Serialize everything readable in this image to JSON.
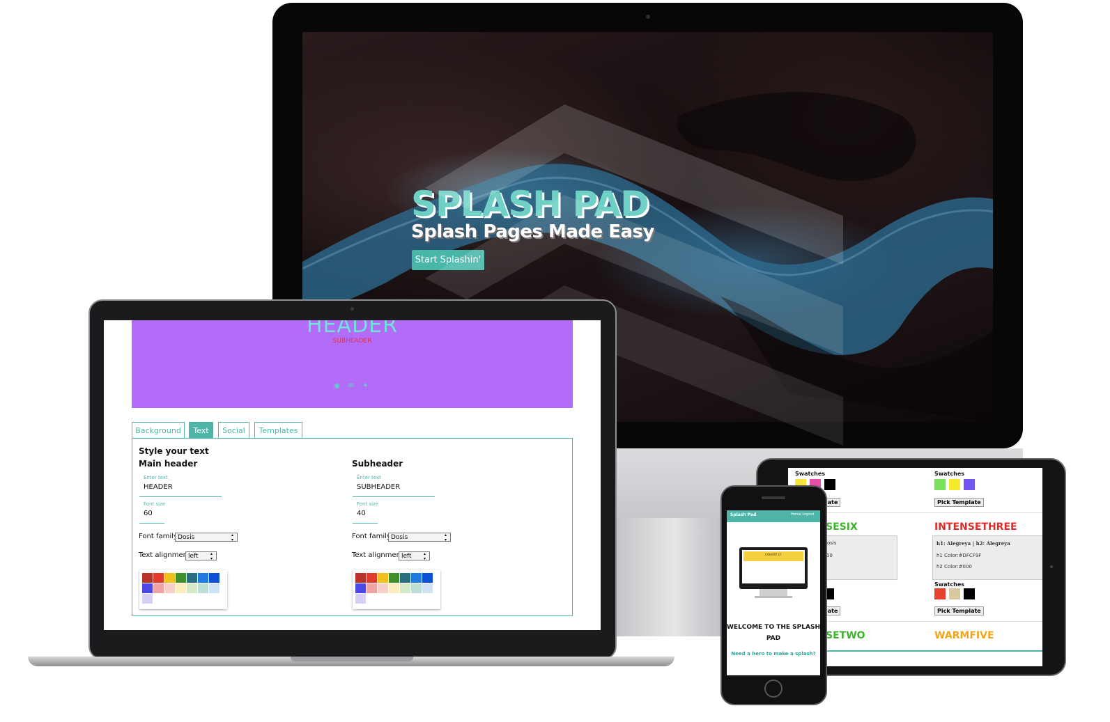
{
  "hero": {
    "title": "SPLASH PAD",
    "subtitle": "Splash Pages Made Easy",
    "cta": "Start Splashin'"
  },
  "editor": {
    "preview": {
      "header": "HEADER",
      "subheader": "SUBHEADER",
      "social_icons": [
        "github-icon",
        "mail-icon",
        "twitter-icon"
      ]
    },
    "tabs": [
      "Background",
      "Text",
      "Social",
      "Templates"
    ],
    "active_tab": "Text",
    "section_title": "Style your text",
    "main": {
      "title": "Main header",
      "text_label": "Enter text",
      "text_value": "HEADER",
      "size_label": "Font size",
      "size_value": "60",
      "family_label": "Font family",
      "family_value": "Dosis",
      "align_label": "Text alignment",
      "align_value": "left"
    },
    "sub": {
      "title": "Subheader",
      "text_label": "Enter text",
      "text_value": "SUBHEADER",
      "size_label": "Font size",
      "size_value": "40",
      "family_label": "Font family",
      "family_value": "Dosis",
      "align_label": "Text alignment",
      "align_value": "left"
    },
    "palette_colors": [
      "#b8322a",
      "#e23b2e",
      "#f2c01c",
      "#3f8f2a",
      "#2b6f7f",
      "#1f7ae0",
      "#0b4fd6",
      "#4c47e6",
      "#f0a3a3",
      "#f6d0c8",
      "#fbeebe",
      "#d5e8c8",
      "#bcded6",
      "#cfe2f4",
      "#d6d0f6"
    ]
  },
  "tablet": {
    "swatches_label": "Swatches",
    "pick_label": "Pick Template",
    "pick_label_cut": "late",
    "templates": [
      {
        "name": "SESIX",
        "color": "#3db42b"
      },
      {
        "name": "INTENSETHREE",
        "color": "#e22828"
      },
      {
        "name": "SETWO",
        "color": "#3db42b"
      },
      {
        "name": "WARMFIVE",
        "color": "#f2a51c"
      }
    ],
    "card_left": {
      "line1": ": Dosis",
      "line2": "0000",
      "line3": "0"
    },
    "card_right": {
      "line1": "h1: Alegreya | h2: Alegreya",
      "line2": "h1 Color:#DFCF9F",
      "line3": "h2 Color:#000"
    },
    "swatch_rows": [
      [
        "#f5e43c",
        "#e84fa8",
        "#000000"
      ],
      [
        "#7be05a",
        "#f6ea2c",
        "#7355f0"
      ],
      [
        "#000000"
      ],
      [
        "#e8432e",
        "#d8c9a0",
        "#000000"
      ]
    ]
  },
  "phone": {
    "brand": "Splash Pad",
    "nav_links": "Home   Logout",
    "welcome": "WELCOME TO THE SPLASH PAD",
    "cta": "Need a hero to make a splash?",
    "mini_banner": "COHORT 17"
  }
}
